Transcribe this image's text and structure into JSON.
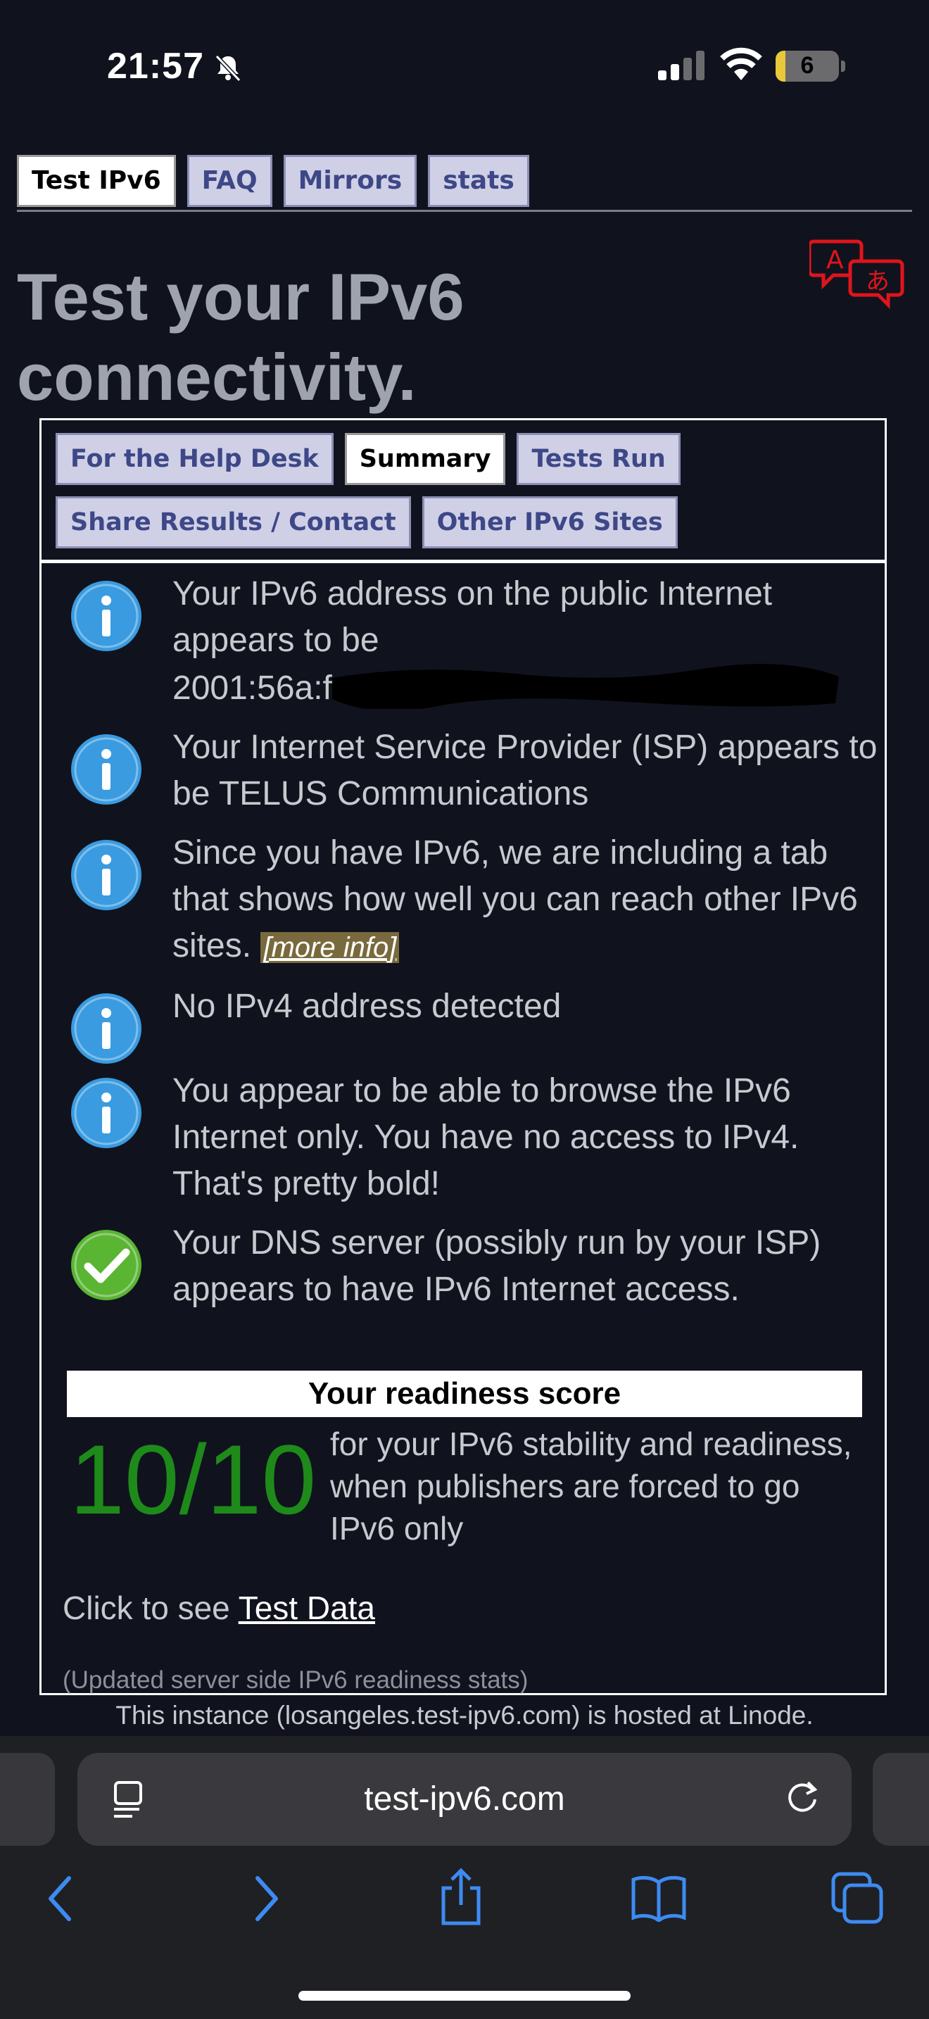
{
  "status_bar": {
    "time": "21:57",
    "battery": "6"
  },
  "top_nav": {
    "tabs": [
      {
        "label": "Test IPv6",
        "active": true
      },
      {
        "label": "FAQ",
        "active": false
      },
      {
        "label": "Mirrors",
        "active": false
      },
      {
        "label": "stats",
        "active": false
      }
    ]
  },
  "heading": "Test your IPv6 connectivity.",
  "translate_icon": "translate-icon",
  "sub_nav": {
    "tabs": [
      {
        "label": "For the Help Desk",
        "active": false
      },
      {
        "label": "Summary",
        "active": true
      },
      {
        "label": "Tests Run",
        "active": false
      },
      {
        "label": "Share Results / Contact",
        "active": false
      },
      {
        "label": "Other IPv6 Sites",
        "active": false
      }
    ]
  },
  "messages": [
    {
      "icon": "info-icon",
      "text_before": "Your IPv6 address on the public Internet appears to be",
      "text_line2": "2001:56a:f"
    },
    {
      "icon": "info-icon",
      "text": "Your Internet Service Provider (ISP) appears to be TELUS Communications"
    },
    {
      "icon": "info-icon",
      "text": "Since you have IPv6, we are including a tab that shows how well you can reach other IPv6 sites.",
      "link": "[more info]"
    },
    {
      "icon": "info-icon",
      "text": "No IPv4 address detected"
    },
    {
      "icon": "info-icon",
      "text": "You appear to be able to browse the IPv6 Internet only. You have no access to IPv4. That's pretty bold!"
    },
    {
      "icon": "check-icon",
      "text": "Your DNS server (possibly run by your ISP) appears to have IPv6 Internet access."
    }
  ],
  "readiness": {
    "title": "Your readiness score",
    "score": "10/10",
    "description": "for your IPv6 stability and readiness, when publishers are forced to go IPv6 only"
  },
  "test_data": {
    "prefix": "Click to see",
    "link": "Test Data"
  },
  "updated_note": "(Updated server side IPv6 readiness stats)",
  "footer": "This instance (losangeles.test-ipv6.com) is hosted at Linode.",
  "browser": {
    "url": "test-ipv6.com"
  },
  "colors": {
    "score_green": "#1e8a1a",
    "info_blue": "#3a9be0",
    "check_green": "#5ab533",
    "tab_bg": "#cfd0e6",
    "tab_text": "#3e4787"
  }
}
